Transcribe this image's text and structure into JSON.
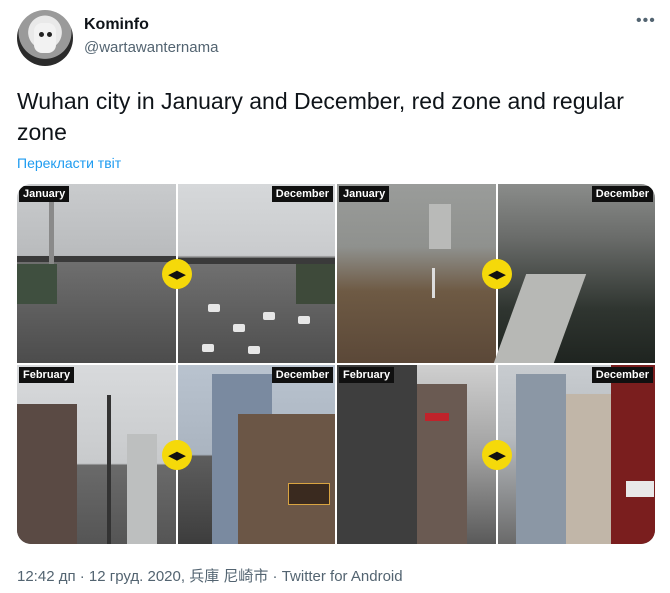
{
  "author": {
    "name": "Kominfo",
    "handle": "@wartawanternama"
  },
  "more_icon": "•••",
  "tweet": {
    "text": "Wuhan city in January and December, red zone and regular zone"
  },
  "translate_link": "Перекласти твіт",
  "photos": [
    {
      "left_label": "January",
      "right_label": "December",
      "handle_icon": "◀▶"
    },
    {
      "left_label": "January",
      "right_label": "December",
      "handle_icon": "◀▶"
    },
    {
      "left_label": "February",
      "right_label": "December",
      "handle_icon": "◀▶"
    },
    {
      "left_label": "February",
      "right_label": "December",
      "handle_icon": "◀▶"
    }
  ],
  "meta": {
    "footer": "12:42 дп · 12 груд. 2020, 兵庫 尼崎市 · Twitter for Android"
  },
  "colors": {
    "link": "#1d9bf0",
    "slider_handle": "#f5d90a",
    "secondary_text": "#536471"
  }
}
